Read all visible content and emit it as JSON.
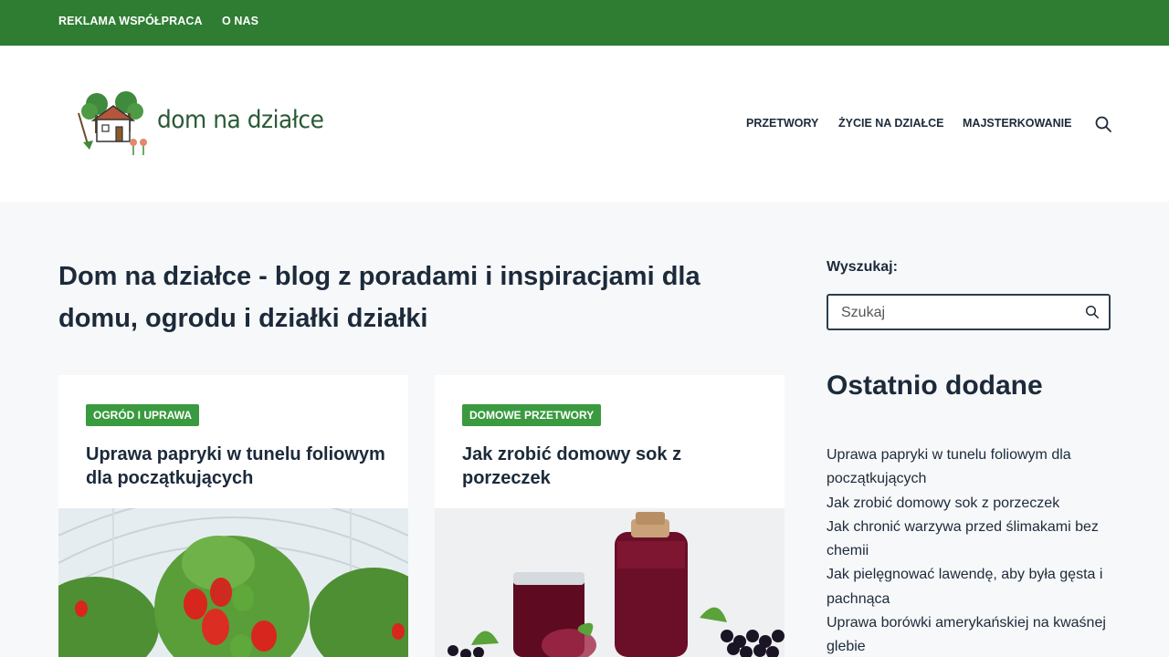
{
  "topbar": {
    "links": [
      "REKLAMA WSPÓŁPRACA",
      "O NAS"
    ]
  },
  "header": {
    "logo_text": "dom na działce",
    "nav": [
      "PRZETWORY",
      "ŻYCIE NA DZIAŁCE",
      "MAJSTERKOWANIE"
    ],
    "search_icon": "search-icon"
  },
  "main": {
    "title": "Dom na działce - blog z poradami i inspiracjami dla domu, ogrodu i działki działki",
    "cards": [
      {
        "category": "OGRÓD I UPRAWA",
        "title": "Uprawa papryki w tunelu foliowym dla początkujących",
        "image": "pepper-greenhouse-photo"
      },
      {
        "category": "DOMOWE PRZETWORY",
        "title": "Jak zrobić domowy sok z porzeczek",
        "image": "currant-juice-photo"
      }
    ]
  },
  "sidebar": {
    "search_label": "Wyszukaj:",
    "search_placeholder": "Szukaj",
    "recent_heading": "Ostatnio dodane",
    "recent": [
      "Uprawa papryki w tunelu foliowym dla początkujących",
      "Jak zrobić domowy sok z porzeczek",
      "Jak chronić warzywa przed ślimakami bez chemii",
      "Jak pielęgnować lawendę, aby była gęsta i pachnąca",
      "Uprawa borówki amerykańskiej na kwaśnej glebie"
    ]
  },
  "colors": {
    "topbar": "#2e7d32",
    "category_badge": "#3a9a3f",
    "text": "#1c2a3a"
  }
}
